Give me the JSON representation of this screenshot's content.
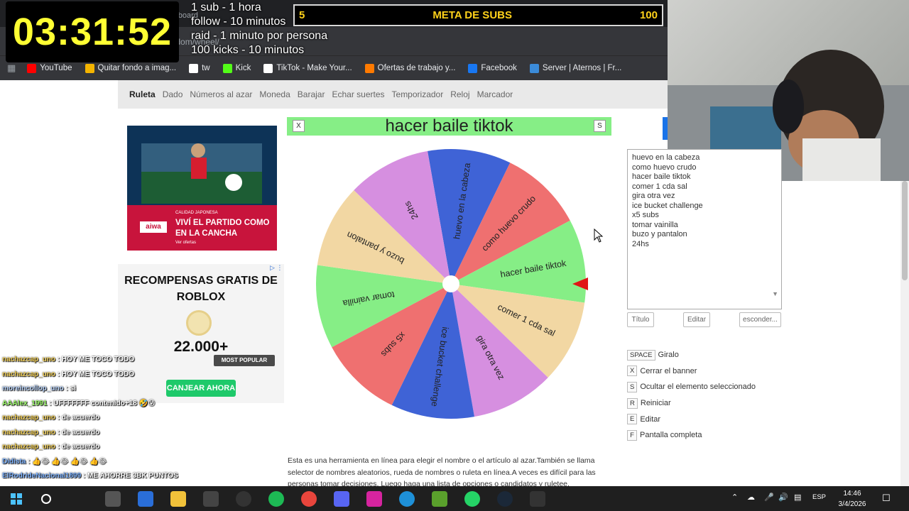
{
  "timer": {
    "value": "03:31:52"
  },
  "rules": [
    "1 sub - 1 hora",
    "follow - 10 minutos",
    "raid - 1 minuto por persona",
    "100 kicks - 10 minutos"
  ],
  "subs_goal": {
    "current": "5",
    "title": "META DE SUBS",
    "target": "100"
  },
  "browser": {
    "tab_label": "Stream - Kick Dashboard",
    "url": "random/wheel/",
    "bookmarks": [
      {
        "label": "YouTube",
        "icon": "youtube-icon",
        "color": "#ff0000"
      },
      {
        "label": "Quitar fondo a imag...",
        "icon": "remove-bg-icon",
        "color": "#f4b400"
      },
      {
        "label": "tw",
        "icon": "x-icon",
        "color": "#ffffff"
      },
      {
        "label": "Kick",
        "icon": "kick-icon",
        "color": "#53fc18"
      },
      {
        "label": "TikTok - Make Your...",
        "icon": "tiktok-icon",
        "color": "#ffffff"
      },
      {
        "label": "Ofertas de trabajo y...",
        "icon": "jobs-icon",
        "color": "#ff7a00"
      },
      {
        "label": "Facebook",
        "icon": "facebook-icon",
        "color": "#1877f2"
      },
      {
        "label": "Server | Aternos | Fr...",
        "icon": "aternos-icon",
        "color": "#3b8bd9"
      }
    ]
  },
  "site_nav": {
    "items": [
      "Ruleta",
      "Dado",
      "Números al azar",
      "Moneda",
      "Barajar",
      "Echar suertes",
      "Temporizador",
      "Reloj",
      "Marcador"
    ],
    "active": "Ruleta"
  },
  "ad_tv": {
    "small": "CALIDAD JAPONESA",
    "headline": "VIVÍ EL PARTIDO COMO EN LA CANCHA",
    "link": "Ver ofertas",
    "logo": "aiwa"
  },
  "ad_roblox": {
    "title": "RECOMPENSAS GRATIS DE ROBLOX",
    "price": "22.000+",
    "badge": "MOST POPULAR",
    "button": "CANJEAR AHORA"
  },
  "chat": [
    {
      "user": "nachazcap_uno",
      "text": "HOY ME TOCO TODO",
      "color": "#f6d35b"
    },
    {
      "user": "nachazcap_uno",
      "text": "HOY ME TOCO TODO",
      "color": "#f6d35b"
    },
    {
      "user": "moreincollop_uno",
      "text": "si",
      "color": "#bcd7ff"
    },
    {
      "user": "AAAlex_1991",
      "text": "UFFFFFFF contenido+18 🤣😰",
      "color": "#9eff6b"
    },
    {
      "user": "nachazcap_uno",
      "text": "de acuerdo",
      "color": "#f6d35b"
    },
    {
      "user": "nachazcap_uno",
      "text": "de acuerdo",
      "color": "#f6d35b"
    },
    {
      "user": "nachazcap_uno",
      "text": "de acuerdo",
      "color": "#f6d35b"
    },
    {
      "user": "Didista",
      "text": "👍😂 👍😂 👍😂 👍😂",
      "color": "#7fb4ff"
    },
    {
      "user": "ElRodrideNacional1899",
      "text": "ME AHORRE 3BK PUNTOS",
      "color": "#7fb4ff"
    },
    {
      "user": "ElRodrideNacional1899",
      "text": "",
      "color": "#2b6ad1"
    },
    {
      "user": "moreincollop_uno",
      "text": "si",
      "color": "#bcd7ff"
    }
  ],
  "wheel": {
    "result": "hacer baile tiktok",
    "close_key": "X",
    "hide_key": "S",
    "options": [
      {
        "label": "huevo en la cabeza",
        "color": "#3f63d6"
      },
      {
        "label": "como huevo crudo",
        "color": "#ef7070"
      },
      {
        "label": "hacer baile tiktok",
        "color": "#86ee86"
      },
      {
        "label": "comer 1 cda sal",
        "color": "#f2d7a3"
      },
      {
        "label": "gira otra vez",
        "color": "#d68fe0"
      },
      {
        "label": "ice bucket challenge",
        "color": "#3f63d6"
      },
      {
        "label": "x5 subs",
        "color": "#ef7070"
      },
      {
        "label": "tomar vainilla",
        "color": "#86ee86"
      },
      {
        "label": "buzo y pantalon",
        "color": "#f2d7a3"
      },
      {
        "label": "24hs",
        "color": "#d68fe0"
      }
    ],
    "pointer_color": "#e01515"
  },
  "textarea": {
    "lines": [
      "huevo en la cabeza",
      "como huevo crudo",
      "hacer baile tiktok",
      "comer 1 cda sal",
      "gira otra vez",
      "ice bucket challenge",
      "x5 subs",
      "tomar vainilla",
      "buzo y pantalon",
      "24hs"
    ]
  },
  "panel_buttons": {
    "title": "Título",
    "edit": "Editar",
    "hide": "esconder..."
  },
  "shortcuts": [
    {
      "key": "SPACE",
      "label": "Giralo"
    },
    {
      "key": "X",
      "label": "Cerrar el banner"
    },
    {
      "key": "S",
      "label": "Ocultar el elemento seleccionado"
    },
    {
      "key": "R",
      "label": "Reiniciar"
    },
    {
      "key": "E",
      "label": "Editar"
    },
    {
      "key": "F",
      "label": "Pantalla completa"
    }
  ],
  "description": "Esta es una herramienta en línea para elegir el nombre o el artículo al azar.También se llama selector de nombres aleatorios, rueda de nombres o ruleta en línea.A veces es difícil para las personas tomar decisiones. Luego haga una lista de opciones o candidatos y ruletee.",
  "taskbar": {
    "lang": "ESP",
    "time": "14:46",
    "date": "3/4/2026"
  }
}
